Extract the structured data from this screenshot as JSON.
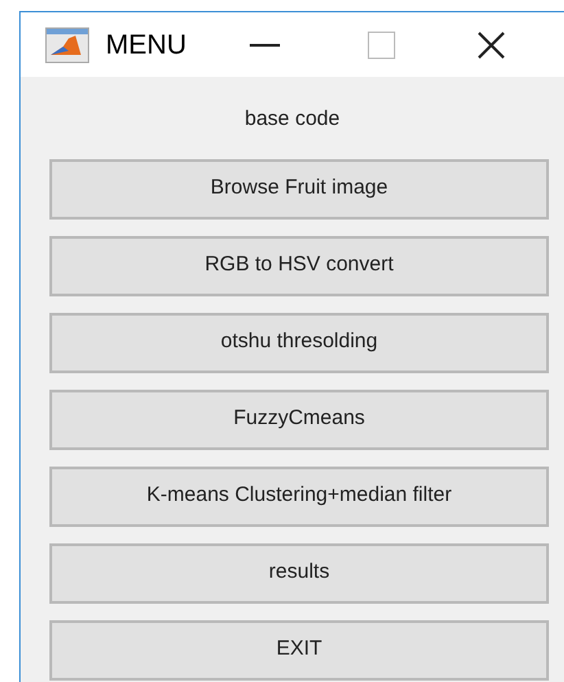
{
  "window": {
    "title": "MENU"
  },
  "heading": "base code",
  "buttons": [
    {
      "label": "Browse Fruit image"
    },
    {
      "label": "RGB to HSV convert"
    },
    {
      "label": "otshu thresolding"
    },
    {
      "label": "FuzzyCmeans"
    },
    {
      "label": "K-means Clustering+median filter"
    },
    {
      "label": "results"
    },
    {
      "label": "EXIT"
    }
  ]
}
